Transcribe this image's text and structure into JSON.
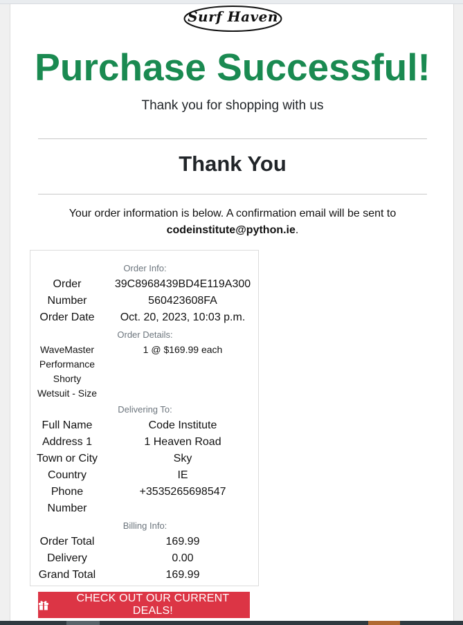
{
  "brand": {
    "logo_text": "Surf Haven"
  },
  "header": {
    "headline": "Purchase Successful!",
    "subhead": "Thank you for shopping with us"
  },
  "thank_you": "Thank You",
  "intro": {
    "text": "Your order information is below. A confirmation email will be sent to",
    "email": "codeinstitute@python.ie",
    "trailing": "."
  },
  "order_info": {
    "label": "Order Info:",
    "order_number_label": [
      "Order",
      "Number"
    ],
    "order_number_value": [
      "39C8968439BD4E119A300",
      "560423608FA"
    ],
    "order_date_label": "Order Date",
    "order_date_value": "Oct. 20, 2023, 10:03 p.m."
  },
  "order_details": {
    "label": "Order Details:",
    "item_name": [
      "WaveMaster",
      "Performance",
      "Shorty",
      "Wetsuit - Size"
    ],
    "item_qty": "1 @ $169.99 each"
  },
  "delivering_to": {
    "label": "Delivering To:",
    "full_name_label": "Full Name",
    "full_name_value": "Code Institute",
    "address1_label": "Address 1",
    "address1_value": "1 Heaven Road",
    "town_label": "Town or City",
    "town_value": "Sky",
    "country_label": "Country",
    "country_value": "IE",
    "phone_label": [
      "Phone",
      "Number"
    ],
    "phone_value": "+3535265698547"
  },
  "billing_info": {
    "label": "Billing Info:",
    "order_total_label": "Order Total",
    "order_total_value": "169.99",
    "delivery_label": "Delivery",
    "delivery_value": "0.00",
    "grand_total_label": "Grand Total",
    "grand_total_value": "169.99"
  },
  "cta": {
    "label": "CHECK OUT OUR CURRENT DEALS!",
    "icon": "gift-icon"
  },
  "colors": {
    "success": "#1a8a51",
    "cta": "#dc3545",
    "muted": "#6c757d"
  }
}
